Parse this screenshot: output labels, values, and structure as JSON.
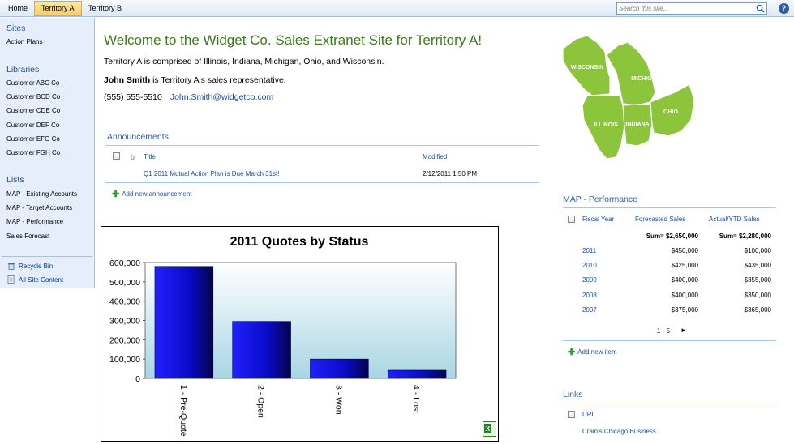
{
  "nav": {
    "tabs": [
      "Home",
      "Territory A",
      "Territory B"
    ],
    "search_placeholder": "Search this site...",
    "help_label": "?"
  },
  "leftnav": {
    "sites_heading": "Sites",
    "sites": [
      "Action Plans"
    ],
    "libraries_heading": "Libraries",
    "libraries": [
      "Customer ABC Co",
      "Customer BCD Co",
      "Customer CDE Co",
      "Customer DEF Co",
      "Customer EFG Co",
      "Customer FGH Co"
    ],
    "lists_heading": "Lists",
    "lists": [
      "MAP - Existing Accounts",
      "MAP - Target Accounts",
      "MAP - Performance",
      "Sales Forecast"
    ],
    "recycle_bin": "Recycle Bin",
    "all_site_content": "All Site Content"
  },
  "main": {
    "welcome": "Welcome to the Widget Co. Sales Extranet Site for Territory A!",
    "intro": "Territory A is comprised of Illinois, Indiana, Michigan, Ohio, and Wisconsin.",
    "rep_name": "John Smith",
    "rep_suffix": " is Territory A's sales representative.",
    "phone": "(555) 555-5510",
    "email": "John.Smith@widgetco.com"
  },
  "announcements": {
    "title": "Announcements",
    "col_title": "Title",
    "col_modified": "Modified",
    "rows": [
      {
        "title": "Q1 2011 Mutual Action Plan is Due March 31st!",
        "modified": "2/12/2011 1:50 PM"
      }
    ],
    "add_label": "Add new announcement"
  },
  "map_states": [
    "WISCONSIN",
    "MICHIGAN",
    "ILLINOIS",
    "INDIANA",
    "OHIO"
  ],
  "performance": {
    "title": "MAP - Performance",
    "col_year": "Fiscal Year",
    "col_forecast": "Forecasted Sales",
    "col_actual": "Actual/YTD Sales",
    "sum_forecast": "Sum= $2,650,000",
    "sum_actual": "Sum= $2,280,000",
    "rows": [
      {
        "year": "2011",
        "forecast": "$450,000",
        "actual": "$100,000"
      },
      {
        "year": "2010",
        "forecast": "$425,000",
        "actual": "$435,000"
      },
      {
        "year": "2009",
        "forecast": "$400,000",
        "actual": "$355,000"
      },
      {
        "year": "2008",
        "forecast": "$400,000",
        "actual": "$350,000"
      },
      {
        "year": "2007",
        "forecast": "$375,000",
        "actual": "$365,000"
      }
    ],
    "paging": "1 - 5",
    "add_label": "Add new item"
  },
  "links": {
    "title": "Links",
    "col_url": "URL",
    "rows": [
      "Crain's Chicago Business"
    ]
  },
  "colors": {
    "accent": "#2c5fa8",
    "welcome": "#3d7a1e",
    "leftnav_bg": "#e6eefb",
    "bar": "#1010d8",
    "map_green": "#8cc43c"
  },
  "chart_data": {
    "type": "bar",
    "title": "2011 Quotes by Status",
    "categories": [
      "1 - Pre-Quote",
      "2 - Open",
      "3 - Won",
      "4 - Lost"
    ],
    "values": [
      580000,
      295000,
      100000,
      42000
    ],
    "ylim": [
      0,
      600000
    ],
    "yticks": [
      "0",
      "100,000",
      "200,000",
      "300,000",
      "400,000",
      "500,000",
      "600,000"
    ],
    "xlabel": "",
    "ylabel": "",
    "grid": false,
    "legend": "none"
  }
}
